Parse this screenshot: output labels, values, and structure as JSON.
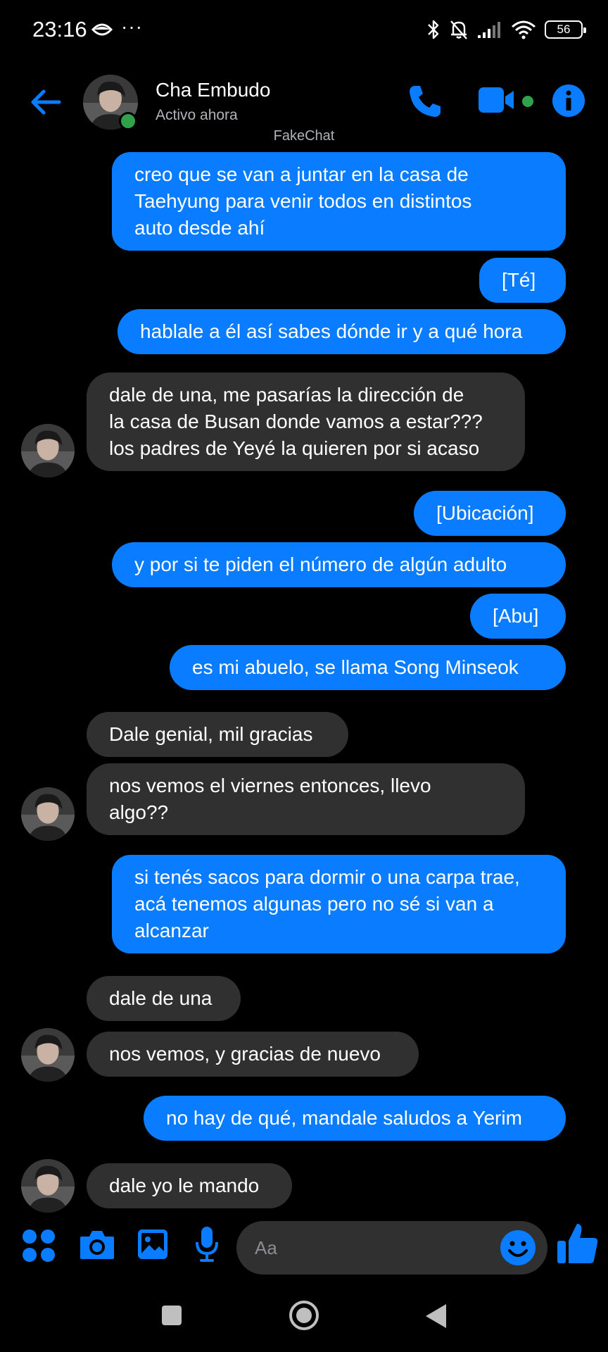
{
  "status_bar": {
    "time": "23:16",
    "dots": "···",
    "battery": "56"
  },
  "header": {
    "name": "Cha Embudo",
    "status": "Activo ahora"
  },
  "watermark": "FakeChat",
  "messages": [
    {
      "side": "sent",
      "lines": [
        "creo que se van a juntar en la casa de",
        "Taehyung para venir todos en distintos",
        "auto desde ahí"
      ]
    },
    {
      "side": "sent",
      "lines": [
        "[Té]"
      ]
    },
    {
      "side": "sent",
      "lines": [
        "hablale a él así sabes dónde ir y a qué hora"
      ]
    },
    {
      "side": "recv",
      "lines": [
        "dale de una, me pasarías la dirección de",
        "la casa de Busan donde vamos a estar???",
        "los padres de Yeyé la quieren por si acaso"
      ]
    },
    {
      "side": "sent",
      "lines": [
        "[Ubicación]"
      ]
    },
    {
      "side": "sent",
      "lines": [
        "y por si te piden el número de algún adulto"
      ]
    },
    {
      "side": "sent",
      "lines": [
        "[Abu]"
      ]
    },
    {
      "side": "sent",
      "lines": [
        "es mi abuelo, se llama Song Minseok"
      ]
    },
    {
      "side": "recv",
      "lines": [
        "Dale genial, mil gracias"
      ]
    },
    {
      "side": "recv",
      "lines": [
        "nos vemos el viernes entonces, llevo",
        "algo??"
      ]
    },
    {
      "side": "sent",
      "lines": [
        "si tenés sacos para dormir o una carpa trae,",
        "acá tenemos algunas pero no sé si van a",
        "alcanzar"
      ]
    },
    {
      "side": "recv",
      "lines": [
        "dale de una"
      ]
    },
    {
      "side": "recv",
      "lines": [
        "nos vemos, y gracias de nuevo"
      ]
    },
    {
      "side": "sent",
      "lines": [
        "no hay de qué, mandale saludos a Yerim"
      ]
    },
    {
      "side": "recv",
      "lines": [
        "dale yo le mando"
      ]
    }
  ],
  "composer": {
    "placeholder": "Aa"
  },
  "icons": {
    "back": "arrow-left-icon",
    "call": "phone-icon",
    "video": "video-camera-icon",
    "info": "info-icon",
    "apps": "grid-dots-icon",
    "camera": "camera-icon",
    "gallery": "image-icon",
    "mic": "microphone-icon",
    "emoji": "smiley-icon",
    "like": "thumbs-up-icon"
  },
  "colors": {
    "accent": "#0a7cff",
    "received_bubble": "#303030",
    "online": "#31a24c",
    "background": "#000000"
  }
}
